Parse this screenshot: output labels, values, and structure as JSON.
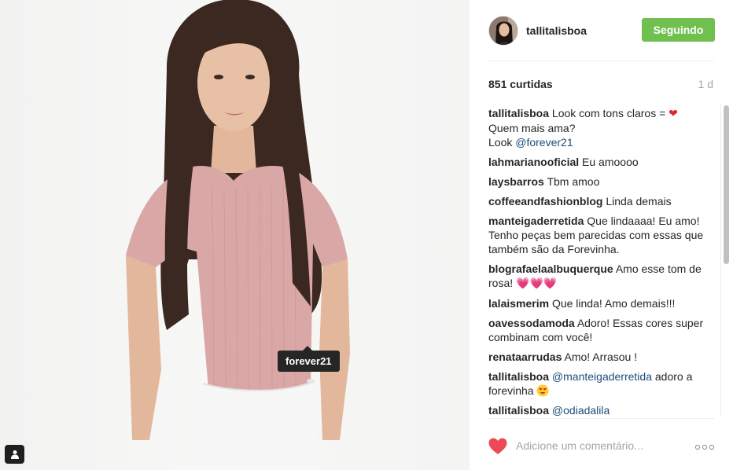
{
  "photo": {
    "tag_label": "forever21"
  },
  "post": {
    "username": "tallitalisboa",
    "follow_label": "Seguindo",
    "likes": "851 curtidas",
    "time": "1 d"
  },
  "caption": {
    "user": "tallitalisboa",
    "text1": " Look com tons claros = ",
    "line2": "Quem mais ama?",
    "line3_prefix": "Look ",
    "mention": "@forever21"
  },
  "comments": [
    {
      "user": "lahmarianooficial",
      "text": " Eu amoooo"
    },
    {
      "user": "laysbarros",
      "text": " Tbm amoo"
    },
    {
      "user": "coffeeandfashionblog",
      "text": " Linda demais"
    },
    {
      "user": "manteigaderretida",
      "text": " Que lindaaaa! Eu amo! Tenho peças bem parecidas com essas que também são da Forevinha."
    },
    {
      "user": "blografaelaalbuquerque",
      "text": " Amo esse tom de rosa! ",
      "emoji": "💗💗💗"
    },
    {
      "user": "lalaismerim",
      "text": " Que linda! Amo demais!!!"
    },
    {
      "user": "oavessodamoda",
      "text": " Adoro! Essas cores super combinam com você!"
    },
    {
      "user": "renataarrudas",
      "text": " Amo! Arrasou !"
    },
    {
      "user": "tallitalisboa",
      "mention": "@manteigaderretida",
      "text": " adoro a forevinha "
    },
    {
      "user": "tallitalisboa",
      "mention": "@odiadalila"
    }
  ],
  "footer": {
    "placeholder": "Adicione um comentário..."
  },
  "icons": {
    "like": "heart-icon",
    "more": "more-options-icon",
    "people": "people-tag-icon"
  },
  "colors": {
    "follow_green": "#70c050",
    "mention_blue": "#1d4c7a",
    "heart_red": "#ed4956"
  }
}
